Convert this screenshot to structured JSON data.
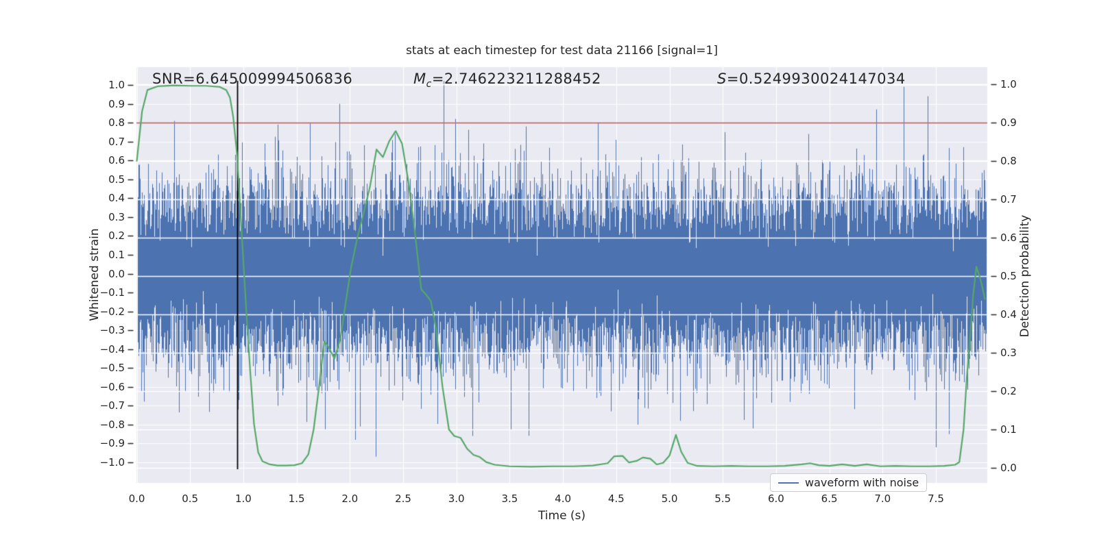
{
  "colors": {
    "waveform_blue": "#4c72b0",
    "probability_green": "#55a868",
    "threshold_red": "#c44e52",
    "marker_black": "#000000",
    "plot_background": "#eaeaf2",
    "grid_white": "#ffffff",
    "text": "#262626"
  },
  "chart_data": {
    "type": "line",
    "title": "stats at each timestep for test data 21166 [signal=1]",
    "xlabel": "Time (s)",
    "ylabel_left": "Whitened strain",
    "ylabel_right": "Detection probability",
    "xlim": [
      0.0,
      8.0
    ],
    "ylim_left": [
      -1.1,
      1.1
    ],
    "ylim_right": [
      -0.04,
      1.045
    ],
    "grid": "on",
    "legend_position": "lower right",
    "annotations": {
      "snr": "SNR=6.645009994506836",
      "mc_symbol": "M",
      "mc_sub": "c",
      "mc_value": "=2.746223211288452",
      "s_symbol": "S",
      "s_value": "=0.5249930024147034"
    },
    "x_ticks": {
      "values": [
        0.0,
        0.5,
        1.0,
        1.5,
        2.0,
        2.5,
        3.0,
        3.5,
        4.0,
        4.5,
        5.0,
        5.5,
        6.0,
        6.5,
        7.0,
        7.5
      ],
      "labels": [
        "0.0",
        "0.5",
        "1.0",
        "1.5",
        "2.0",
        "2.5",
        "3.0",
        "3.5",
        "4.0",
        "4.5",
        "5.0",
        "5.5",
        "6.0",
        "6.5",
        "7.0",
        "7.5"
      ]
    },
    "left_ticks": {
      "values": [
        1.0,
        0.9,
        0.8,
        0.7,
        0.6,
        0.5,
        0.4,
        0.3,
        0.2,
        0.1,
        0.0,
        -0.1,
        -0.2,
        -0.3,
        -0.4,
        -0.5,
        -0.6,
        -0.7,
        -0.8,
        -0.9,
        -1.0
      ],
      "labels": [
        "1.0",
        "0.9",
        "0.8",
        "0.7",
        "0.6",
        "0.5",
        "0.4",
        "0.3",
        "0.2",
        "0.1",
        "0.0",
        "−0.1",
        "−0.2",
        "−0.3",
        "−0.4",
        "−0.5",
        "−0.6",
        "−0.7",
        "−0.8",
        "−0.9",
        "−1.0"
      ]
    },
    "right_ticks": {
      "values": [
        1.0,
        0.9,
        0.8,
        0.7,
        0.6,
        0.5,
        0.4,
        0.3,
        0.2,
        0.1,
        0.0
      ],
      "labels": [
        "1.0",
        "0.9",
        "0.8",
        "0.7",
        "0.6",
        "0.5",
        "0.4",
        "0.3",
        "0.2",
        "0.1",
        "0.0"
      ]
    },
    "threshold_line": {
      "axis": "right",
      "value": 0.9,
      "color": "#c44e52"
    },
    "event_marker_line": {
      "time": 0.94,
      "color": "#000000"
    },
    "legend": {
      "entries": [
        {
          "label": "waveform with noise",
          "color": "#4c72b0"
        }
      ]
    },
    "series": [
      {
        "name": "waveform with noise",
        "kind": "noise-band",
        "axis": "left",
        "color": "#4c72b0",
        "noise": {
          "seed": 21166,
          "sigma": 0.22,
          "samples_per_side": 7,
          "t_start": 0.0,
          "t_end": 7.97,
          "clip": 1.0
        },
        "notable_spikes": [
          {
            "t": 0.35,
            "v": 0.81
          },
          {
            "t": 0.95,
            "v": -0.72
          },
          {
            "t": 1.32,
            "v": 0.79
          },
          {
            "t": 1.9,
            "v": 0.9
          },
          {
            "t": 2.05,
            "v": -0.88
          },
          {
            "t": 2.24,
            "v": -0.97
          },
          {
            "t": 2.42,
            "v": 0.74
          },
          {
            "t": 2.88,
            "v": 1.02
          },
          {
            "t": 2.99,
            "v": 0.82
          },
          {
            "t": 3.15,
            "v": -0.86
          },
          {
            "t": 3.65,
            "v": 0.78
          },
          {
            "t": 4.33,
            "v": 0.8
          },
          {
            "t": 4.7,
            "v": -0.8
          },
          {
            "t": 5.1,
            "v": -0.78
          },
          {
            "t": 5.52,
            "v": 0.75
          },
          {
            "t": 5.78,
            "v": -0.82
          },
          {
            "t": 6.3,
            "v": 0.74
          },
          {
            "t": 6.94,
            "v": 0.87
          },
          {
            "t": 7.2,
            "v": 0.99
          },
          {
            "t": 7.42,
            "v": 0.94
          },
          {
            "t": 7.5,
            "v": -0.92
          },
          {
            "t": 7.62,
            "v": -0.85
          }
        ]
      },
      {
        "name": "detection probability",
        "kind": "line",
        "axis": "right",
        "color": "#55a868",
        "points": [
          [
            0.0,
            0.8
          ],
          [
            0.05,
            0.93
          ],
          [
            0.1,
            0.985
          ],
          [
            0.2,
            0.995
          ],
          [
            0.35,
            0.997
          ],
          [
            0.5,
            0.996
          ],
          [
            0.65,
            0.996
          ],
          [
            0.78,
            0.993
          ],
          [
            0.84,
            0.985
          ],
          [
            0.875,
            0.965
          ],
          [
            0.905,
            0.915
          ],
          [
            0.94,
            0.82
          ],
          [
            0.97,
            0.68
          ],
          [
            1.0,
            0.54
          ],
          [
            1.03,
            0.4
          ],
          [
            1.065,
            0.25
          ],
          [
            1.1,
            0.115
          ],
          [
            1.14,
            0.04
          ],
          [
            1.18,
            0.017
          ],
          [
            1.25,
            0.009
          ],
          [
            1.32,
            0.006
          ],
          [
            1.4,
            0.006
          ],
          [
            1.48,
            0.007
          ],
          [
            1.55,
            0.012
          ],
          [
            1.61,
            0.035
          ],
          [
            1.66,
            0.1
          ],
          [
            1.71,
            0.21
          ],
          [
            1.76,
            0.33
          ],
          [
            1.8,
            0.315
          ],
          [
            1.855,
            0.285
          ],
          [
            1.91,
            0.335
          ],
          [
            1.96,
            0.43
          ],
          [
            2.01,
            0.52
          ],
          [
            2.07,
            0.6
          ],
          [
            2.13,
            0.665
          ],
          [
            2.19,
            0.735
          ],
          [
            2.25,
            0.83
          ],
          [
            2.31,
            0.81
          ],
          [
            2.37,
            0.852
          ],
          [
            2.43,
            0.878
          ],
          [
            2.49,
            0.845
          ],
          [
            2.55,
            0.745
          ],
          [
            2.61,
            0.615
          ],
          [
            2.67,
            0.465
          ],
          [
            2.72,
            0.45
          ],
          [
            2.76,
            0.435
          ],
          [
            2.81,
            0.36
          ],
          [
            2.87,
            0.21
          ],
          [
            2.93,
            0.1
          ],
          [
            2.98,
            0.083
          ],
          [
            3.04,
            0.078
          ],
          [
            3.1,
            0.05
          ],
          [
            3.16,
            0.034
          ],
          [
            3.22,
            0.028
          ],
          [
            3.28,
            0.015
          ],
          [
            3.36,
            0.008
          ],
          [
            3.5,
            0.004
          ],
          [
            3.7,
            0.003
          ],
          [
            3.9,
            0.004
          ],
          [
            4.1,
            0.004
          ],
          [
            4.28,
            0.006
          ],
          [
            4.42,
            0.012
          ],
          [
            4.48,
            0.03
          ],
          [
            4.56,
            0.031
          ],
          [
            4.62,
            0.014
          ],
          [
            4.69,
            0.018
          ],
          [
            4.75,
            0.027
          ],
          [
            4.82,
            0.024
          ],
          [
            4.88,
            0.009
          ],
          [
            4.94,
            0.013
          ],
          [
            5.0,
            0.032
          ],
          [
            5.06,
            0.086
          ],
          [
            5.11,
            0.042
          ],
          [
            5.17,
            0.013
          ],
          [
            5.26,
            0.005
          ],
          [
            5.42,
            0.004
          ],
          [
            5.58,
            0.005
          ],
          [
            5.74,
            0.004
          ],
          [
            5.92,
            0.004
          ],
          [
            6.08,
            0.005
          ],
          [
            6.24,
            0.009
          ],
          [
            6.32,
            0.012
          ],
          [
            6.4,
            0.007
          ],
          [
            6.5,
            0.005
          ],
          [
            6.62,
            0.009
          ],
          [
            6.74,
            0.005
          ],
          [
            6.85,
            0.009
          ],
          [
            6.98,
            0.004
          ],
          [
            7.12,
            0.005
          ],
          [
            7.28,
            0.004
          ],
          [
            7.44,
            0.004
          ],
          [
            7.58,
            0.005
          ],
          [
            7.68,
            0.008
          ],
          [
            7.72,
            0.015
          ],
          [
            7.76,
            0.1
          ],
          [
            7.79,
            0.235
          ],
          [
            7.82,
            0.335
          ],
          [
            7.85,
            0.45
          ],
          [
            7.88,
            0.525
          ],
          [
            7.92,
            0.49
          ],
          [
            7.96,
            0.44
          ]
        ]
      }
    ]
  }
}
